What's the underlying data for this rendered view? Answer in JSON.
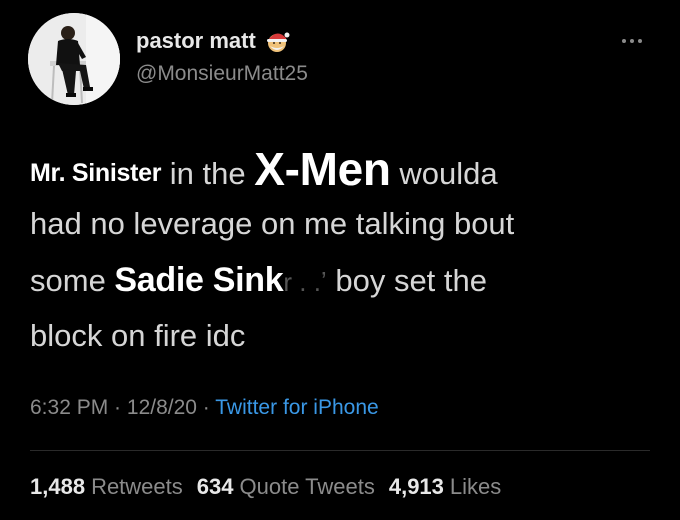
{
  "user": {
    "display_name": "pastor matt",
    "handle": "@MonsieurMatt25",
    "avatar_icon": "profile-photo-man-in-black-on-chair",
    "name_emoji": "santa-hat-face-emoji"
  },
  "tweet": {
    "lines": [
      {
        "overlay": "Mr. Sinister",
        "text": " in the ",
        "overlay2": "X-Men",
        "tail": " woulda"
      },
      {
        "text": "had no leverage on me talking bout"
      },
      {
        "pre": "some ",
        "overlay": "Sadie Sink",
        "smudge": "r . .ʼ",
        "tail": " boy set the"
      },
      {
        "text": "block on fire idc"
      }
    ]
  },
  "meta": {
    "time": "6:32 PM",
    "sep1": " · ",
    "date": "12/8/20",
    "sep2": " · ",
    "source": "Twitter for iPhone"
  },
  "stats": {
    "retweets_count": "1,488",
    "retweets_label": "Retweets",
    "quotes_count": "634",
    "quotes_label": "Quote Tweets",
    "likes_count": "4,913",
    "likes_label": "Likes"
  },
  "colors": {
    "background": "#000000",
    "link": "#3a98e6",
    "muted": "#8b8b8b"
  }
}
